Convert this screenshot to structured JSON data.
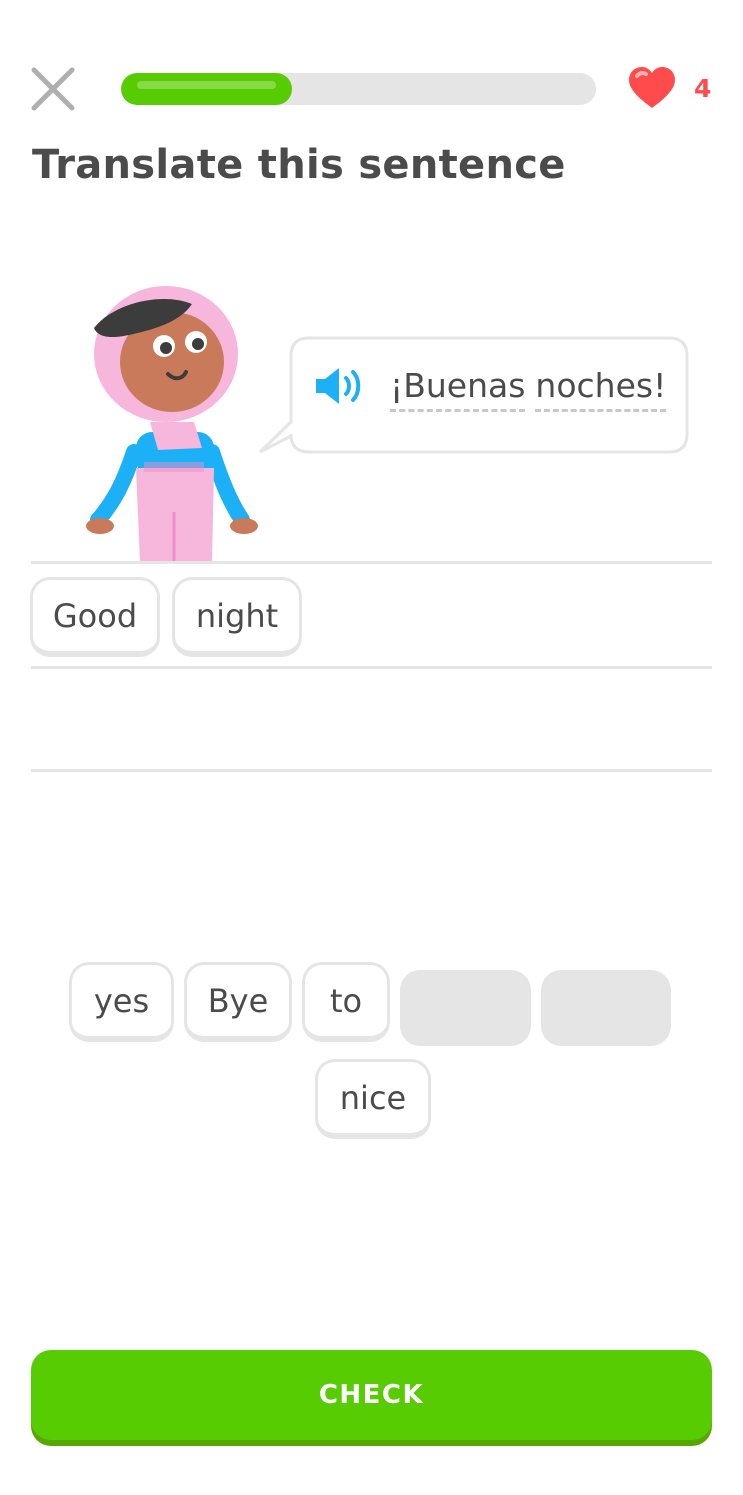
{
  "header": {
    "close_icon": "close-icon",
    "progress": 0.36,
    "hearts_icon": "heart-icon",
    "hearts_count": "4"
  },
  "title": "Translate this sentence",
  "prompt": {
    "speaker_icon": "speaker-icon",
    "words": [
      "¡Buenas",
      "noches!"
    ]
  },
  "answer": {
    "words": [
      "Good",
      "night"
    ]
  },
  "word_bank": {
    "row1": [
      "yes",
      "Bye",
      "to"
    ],
    "row2": [
      "nice"
    ],
    "used_slots": 2
  },
  "check_button": "CHECK",
  "colors": {
    "accent": "#58cc02",
    "heart": "#ff4b4b",
    "speaker": "#1cb0f6",
    "track": "#e5e5e5"
  }
}
